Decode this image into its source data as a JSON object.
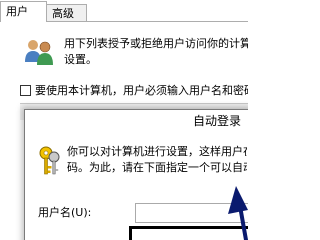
{
  "tabs": [
    {
      "label": "用户"
    },
    {
      "label": "高级"
    }
  ],
  "users_panel": {
    "intro_line1": "用下列表授予或拒绝用户访问你的计算机",
    "intro_line2": "设置。",
    "must_enter_label": "要使用本计算机，用户必须输入用户名和密码",
    "must_enter_checked": false
  },
  "auto_signin": {
    "title": "自动登录",
    "desc_line1": "你可以对计算机进行设置，这样用户在",
    "desc_line2": "码。为此，请在下面指定一个可以自动",
    "username_label": "用户名(U):",
    "username_value": ""
  },
  "icons": [
    "users-icon",
    "keys-icon",
    "arrow-annotation-icon"
  ],
  "colors": {
    "dialog_border": "#7a7a7a",
    "tab_border": "#adadad",
    "annotation": "#0a1a6e"
  }
}
